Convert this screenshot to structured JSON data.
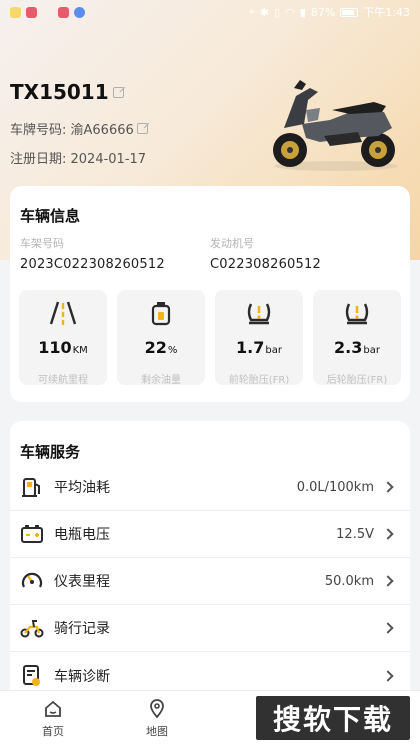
{
  "status_bar": {
    "battery": "87%",
    "time": "下午1:43",
    "app_colors": [
      "#f5d76e",
      "#e35d6a",
      "#e35d6a",
      "#5b8def"
    ]
  },
  "vehicle": {
    "name": "TX15011",
    "plate_label": "车牌号码: 渝A66666",
    "reg_label": "注册日期: 2024-01-17"
  },
  "info_card": {
    "title": "车辆信息",
    "frame_label": "车架号码",
    "frame_value": "2023C022308260512",
    "engine_label": "发动机号",
    "engine_value": "C022308260512",
    "stats": [
      {
        "value": "110",
        "unit": "KM",
        "label": "可续航里程",
        "icon": "road-icon"
      },
      {
        "value": "22",
        "unit": "%",
        "label": "剩余油量",
        "icon": "fuel-can-icon"
      },
      {
        "value": "1.7",
        "unit": "bar",
        "label": "前轮胎压(FR)",
        "icon": "tire-pressure-icon"
      },
      {
        "value": "2.3",
        "unit": "bar",
        "label": "后轮胎压(FR)",
        "icon": "tire-pressure-icon"
      }
    ]
  },
  "service_card": {
    "title": "车辆服务",
    "items": [
      {
        "label": "平均油耗",
        "value": "0.0L/100km",
        "icon": "fuel-pump-icon"
      },
      {
        "label": "电瓶电压",
        "value": "12.5V",
        "icon": "battery-icon"
      },
      {
        "label": "仪表里程",
        "value": "50.0km",
        "icon": "gauge-icon"
      },
      {
        "label": "骑行记录",
        "value": "",
        "icon": "scooter-icon"
      },
      {
        "label": "车辆诊断",
        "value": "",
        "icon": "diagnosis-icon"
      }
    ]
  },
  "tabbar": {
    "home": "首页",
    "map": "地图"
  },
  "watermark": "搜软下载",
  "colors": {
    "accent": "#f2b21b",
    "dark_icon": "#2b2b2b"
  }
}
